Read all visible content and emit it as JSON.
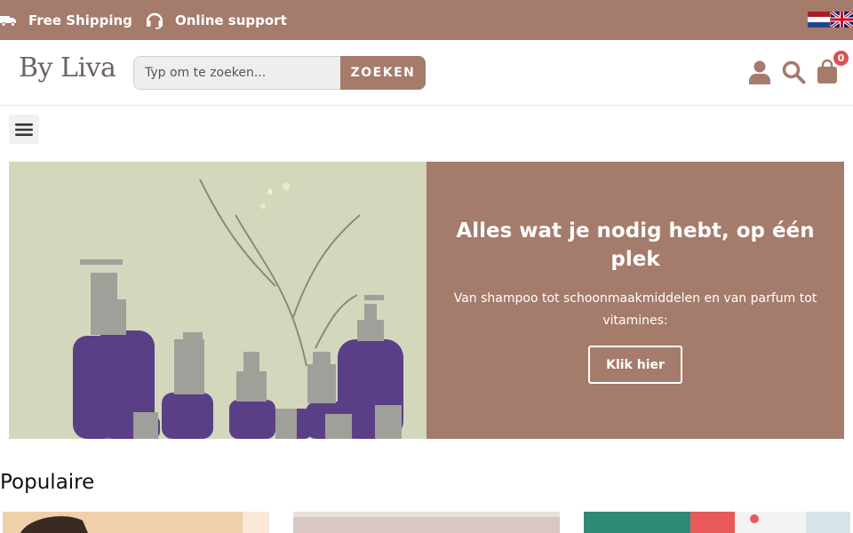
{
  "topbar": {
    "shipping_label": "Free Shipping",
    "support_label": "Online support",
    "shipping_icon": "truck-icon",
    "support_icon": "headset-icon",
    "flags": [
      "dutch-flag",
      "uk-flag"
    ]
  },
  "header": {
    "logo": "By Liva",
    "search_placeholder": "Typ om te zoeken...",
    "search_button": "ZOEKEN",
    "cart_count": "0",
    "icons": [
      "user-icon",
      "search-icon",
      "shopping-bag-icon"
    ]
  },
  "hero": {
    "title": "Alles wat je nodig hebt, op één plek",
    "text": "Van shampoo tot schoonmaakmiddelen en van parfum tot vitamines:",
    "button": "Klik hier"
  },
  "section": {
    "title": "Populaire"
  },
  "colors": {
    "brand": "#a57b6c",
    "badge": "#d9534f",
    "hero_image_bg": "#d3d8bd",
    "bottle": "#5b3f86"
  }
}
